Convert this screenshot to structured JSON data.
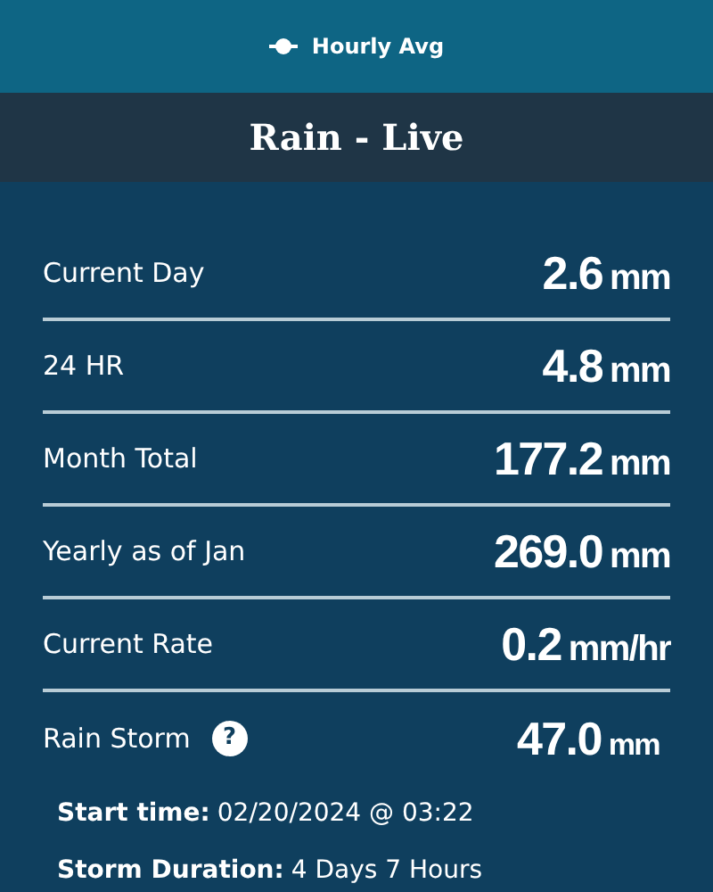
{
  "top_bar": {
    "label": "Hourly Avg"
  },
  "title": "Rain - Live",
  "rows": [
    {
      "label": "Current Day",
      "value": "2.6",
      "unit": "mm"
    },
    {
      "label": "24 HR",
      "value": "4.8",
      "unit": "mm"
    },
    {
      "label": "Month Total",
      "value": "177.2",
      "unit": "mm"
    },
    {
      "label": "Yearly as of Jan",
      "value": "269.0",
      "unit": "mm"
    },
    {
      "label": "Current Rate",
      "value": "0.2",
      "unit": "mm/hr"
    }
  ],
  "storm": {
    "label": "Rain Storm",
    "help": "?",
    "value": "47.0",
    "unit": "mm",
    "details": [
      {
        "label": "Start time:",
        "value": "02/20/2024 @ 03:22"
      },
      {
        "label": "Storm Duration:",
        "value": "4 Days 7 Hours"
      }
    ]
  }
}
